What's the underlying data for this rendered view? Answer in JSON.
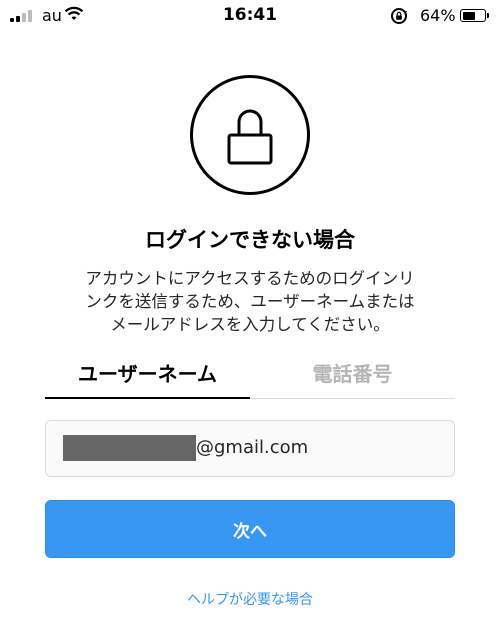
{
  "status_bar": {
    "carrier": "au",
    "time": "16:41",
    "battery_percent": "64%",
    "battery_level": 0.64,
    "signal_bars_active": 2,
    "signal_bars_total": 4
  },
  "header": {
    "icon": "lock-icon",
    "title": "ログインできない場合",
    "description_lines": [
      "アカウントにアクセスするためのログインリ",
      "ンクを送信するため、ユーザーネームまたは",
      "メールアドレスを入力してください。"
    ]
  },
  "tabs": {
    "username": "ユーザーネーム",
    "phone": "電話番号",
    "active": "username"
  },
  "form": {
    "input_value": "@gmail.com",
    "next_label": "次へ"
  },
  "footer": {
    "help_link": "ヘルプが必要な場合"
  },
  "colors": {
    "accent": "#3897f0",
    "inactive_tab": "#b5b5b5",
    "field_background": "#fafafa",
    "border": "#dbdbdb"
  }
}
